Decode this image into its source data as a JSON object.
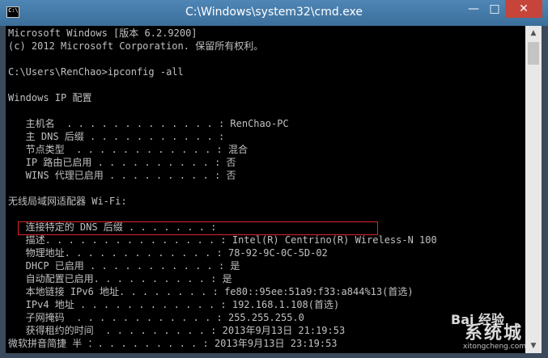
{
  "window": {
    "title": "C:\\Windows\\system32\\cmd.exe",
    "icon": "console-icon",
    "controls": {
      "minimize": "—",
      "maximize": "□",
      "close": "✕"
    }
  },
  "console": {
    "lines": [
      "Microsoft Windows [版本 6.2.9200]",
      "(c) 2012 Microsoft Corporation. 保留所有权利。",
      "",
      "C:\\Users\\RenChao>ipconfig -all",
      "",
      "Windows IP 配置",
      "",
      "   主机名  . . . . . . . . . . . . . : RenChao-PC",
      "   主 DNS 后缀 . . . . . . . . . . . :",
      "   节点类型  . . . . . . . . . . . . : 混合",
      "   IP 路由已启用 . . . . . . . . . . : 否",
      "   WINS 代理已启用 . . . . . . . . . : 否",
      "",
      "无线局域网适配器 Wi-Fi:",
      "",
      "   连接特定的 DNS 后缀 . . . . . . . :",
      "   描述. . . . . . . . . . . . . . . : Intel(R) Centrino(R) Wireless-N 100",
      "   物理地址. . . . . . . . . . . . . : 78-92-9C-0C-5D-02",
      "   DHCP 已启用 . . . . . . . . . . . : 是",
      "   自动配置已启用. . . . . . . . . . : 是",
      "   本地链接 IPv6 地址. . . . . . . . : fe80::95ee:51a9:f33:a844%13(首选)",
      "   IPv4 地址 . . . . . . . . . . . . : 192.168.1.108(首选)",
      "   子网掩码  . . . . . . . . . . . . : 255.255.255.0",
      "   获得租约的时间  . . . . . . . . . : 2013年9月13日 21:19:53",
      "微软拼音简捷 半 ：. . . . . . . . . : 2013年9月13日 23:19:53"
    ]
  },
  "watermark": {
    "logo": "Bai 经验",
    "site": "xitongcheng.com",
    "brand": "系统城"
  }
}
